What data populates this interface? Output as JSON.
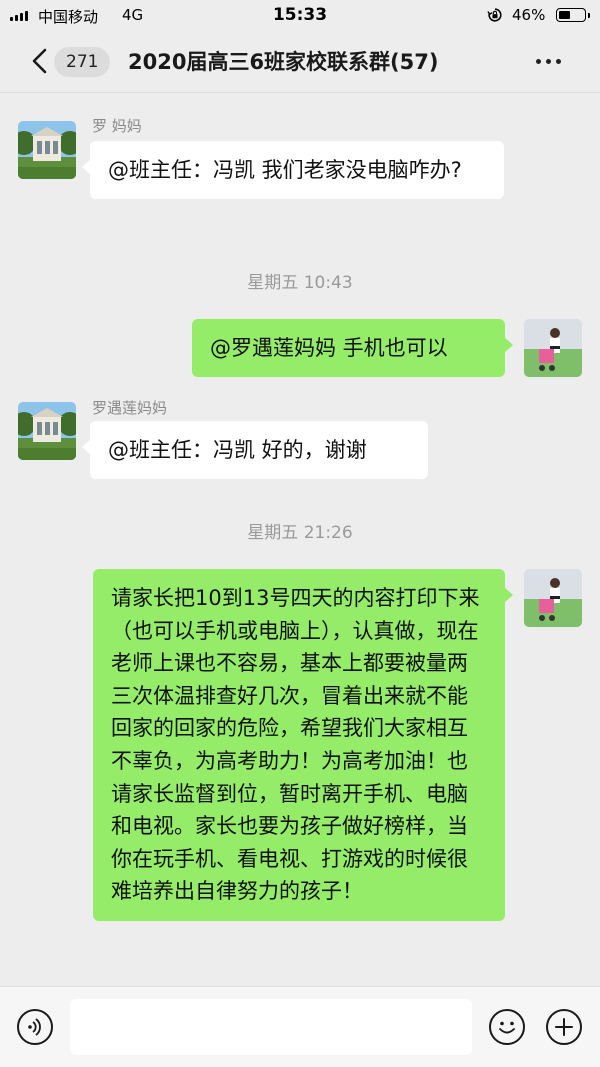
{
  "status_bar": {
    "carrier": "中国移动",
    "network": "4G",
    "time": "15:33",
    "battery_percent": "46%",
    "battery_level": 0.46
  },
  "nav": {
    "unread_badge": "271",
    "title": "2020届高三6班家校联系群(57)"
  },
  "messages": [
    {
      "sender_name": "罗  妈妈",
      "text": "@班主任：冯凯 我们老家没电脑咋办?",
      "direction": "in"
    },
    {
      "timestamp": "星期五 10:43"
    },
    {
      "text": "@罗遇莲妈妈 手机也可以",
      "direction": "out"
    },
    {
      "sender_name": "罗遇莲妈妈",
      "text": "@班主任：冯凯 好的，谢谢",
      "direction": "in"
    },
    {
      "timestamp": "星期五 21:26"
    },
    {
      "text": "请家长把10到13号四天的内容打印下来（也可以手机或电脑上），认真做，现在老师上课也不容易，基本上都要被量两三次体温排查好几次，冒着出来就不能回家的回家的危险，希望我们大家相互不辜负，为高考助力！为高考加油！也请家长监督到位，暂时离开手机、电脑和电视。家长也要为孩子做好榜样，当你在玩手机、看电视、打游戏的时候很难培养出自律努力的孩子！",
      "direction": "out"
    }
  ],
  "colors": {
    "background": "#ededed",
    "outgoing_bubble": "#95ec69",
    "incoming_bubble": "#ffffff"
  },
  "icons": [
    "signal-icon",
    "lock-rotation-icon",
    "battery-icon",
    "back-chevron-icon",
    "more-dots-icon",
    "voice-icon",
    "emoji-icon",
    "plus-icon"
  ]
}
